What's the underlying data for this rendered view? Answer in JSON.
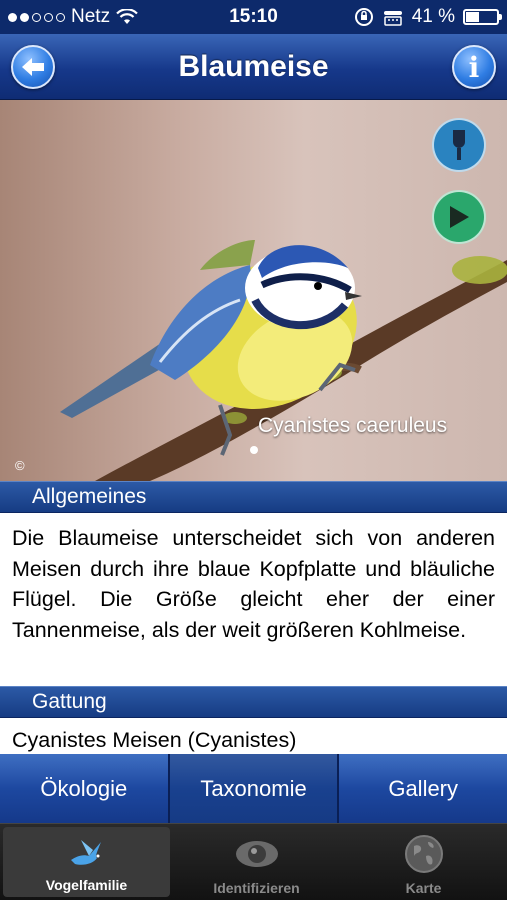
{
  "status_bar": {
    "carrier": "Netz",
    "time": "15:10",
    "battery_percent": "41 %",
    "icons": [
      "signal-dots-icon",
      "wifi-icon",
      "orientation-lock-icon",
      "tty-icon",
      "battery-icon"
    ]
  },
  "nav": {
    "title": "Blaumeise",
    "back_icon": "back-arrow-icon",
    "info_label": "i"
  },
  "photo": {
    "caption": "Cyanistes caeruleus",
    "copyright": "©",
    "buttons": [
      "audio-icon",
      "play-icon"
    ]
  },
  "sections": {
    "general_title": "Allgemeines",
    "general_text": "Die Blaumeise unterscheidet sich von anderen Meisen durch ihre blaue Kopfplatte und bläuliche Flügel. Die Größe gleicht eher der einer Tannenmeise, als der weit größeren Kohlmeise.",
    "genus_title": "Gattung",
    "genus_text": "Cyanistes Meisen (Cyanistes)"
  },
  "segments": [
    {
      "label": "Ökologie"
    },
    {
      "label": "Taxonomie"
    },
    {
      "label": "Gallery"
    }
  ],
  "tabs": [
    {
      "label": "Vogelfamilie",
      "icon": "bird-icon",
      "active": true
    },
    {
      "label": "Identifizieren",
      "icon": "eye-icon",
      "active": false
    },
    {
      "label": "Karte",
      "icon": "globe-icon",
      "active": false
    }
  ],
  "colors": {
    "nav_blue": "#16388a",
    "audio_button": "#2a83c0",
    "play_button": "#2aa76c"
  }
}
